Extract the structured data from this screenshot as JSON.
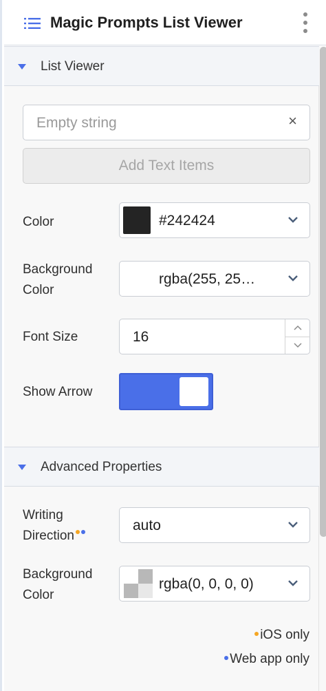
{
  "header": {
    "title": "Magic Prompts List Viewer",
    "menu_icon": "list-icon",
    "more_icon": "kebab-menu-icon"
  },
  "list_viewer": {
    "section_label": "List Viewer",
    "text_input_placeholder": "Empty string",
    "clear_symbol": "×",
    "add_button_label": "Add Text Items"
  },
  "properties": {
    "color_label": "Color",
    "color_value": "#242424",
    "background_color_label_line1": "Background",
    "background_color_label_line2": "Color",
    "background_color_value": "rgba(255, 25…",
    "font_size_label": "Font Size",
    "font_size_value": "16",
    "show_arrow_label": "Show Arrow",
    "show_arrow_on": true
  },
  "advanced": {
    "section_label": "Advanced Properties",
    "writing_direction_label_line1": "Writing",
    "writing_direction_label_line2": "Direction",
    "writing_direction_value": "auto",
    "background_color_label_line1": "Background",
    "background_color_label_line2": "Color",
    "background_color_value": "rgba(0, 0, 0, 0)"
  },
  "legend": {
    "ios_only": "iOS only",
    "web_only": "Web app only"
  },
  "colors": {
    "accent": "#4a6fe8",
    "ios_dot": "#f5a623",
    "web_dot": "#4a6fe8",
    "swatch": "#242424"
  }
}
